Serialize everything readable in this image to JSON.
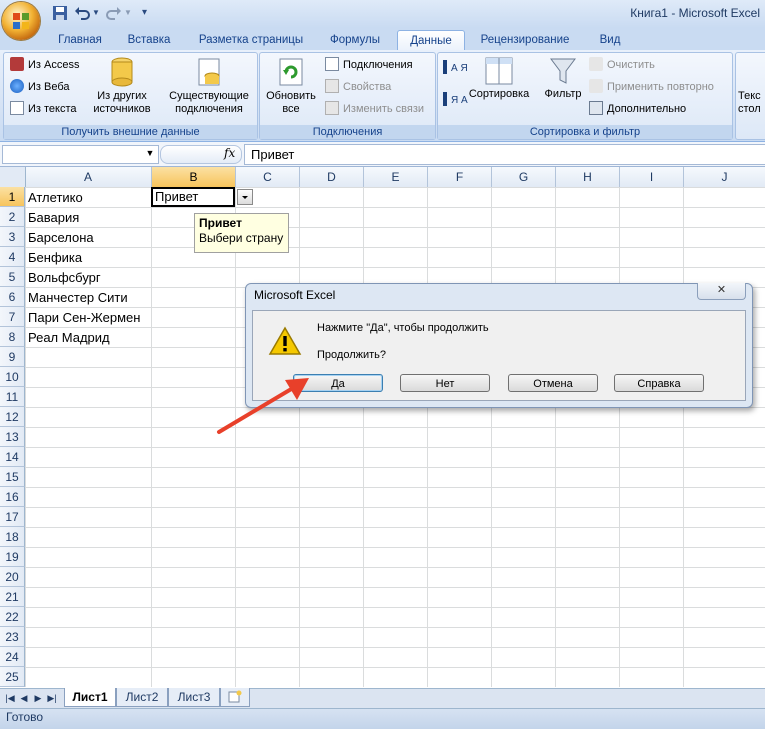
{
  "window": {
    "title": "Книга1 - Microsoft Excel"
  },
  "tabs": [
    {
      "label": "Главная",
      "active": false
    },
    {
      "label": "Вставка",
      "active": false
    },
    {
      "label": "Разметка страницы",
      "active": false
    },
    {
      "label": "Формулы",
      "active": false
    },
    {
      "label": "Данные",
      "active": true
    },
    {
      "label": "Рецензирование",
      "active": false
    },
    {
      "label": "Вид",
      "active": false
    }
  ],
  "ribbon": {
    "get_external": {
      "label": "Получить внешние данные",
      "from_access": "Из Access",
      "from_web": "Из Веба",
      "from_text": "Из текста",
      "from_other_1": "Из других",
      "from_other_2": "источников",
      "existing_1": "Существующие",
      "existing_2": "подключения"
    },
    "connections": {
      "label": "Подключения",
      "refresh_1": "Обновить",
      "refresh_2": "все",
      "connections": "Подключения",
      "properties": "Свойства",
      "edit_links": "Изменить связи"
    },
    "sort_filter": {
      "label": "Сортировка и фильтр",
      "sort": "Сортировка",
      "filter": "Фильтр",
      "clear": "Очистить",
      "reapply": "Применить повторно",
      "advanced": "Дополнительно",
      "az_top": "А Я",
      "az_bottom": "Я А"
    },
    "partial": {
      "line1": "Текс",
      "line2": "стол"
    }
  },
  "formula_bar": {
    "name_box": "",
    "fx": "fx",
    "value": "Привет"
  },
  "columns": [
    "A",
    "B",
    "C",
    "D",
    "E",
    "F",
    "G",
    "H",
    "I",
    "J"
  ],
  "rows": [
    "1",
    "2",
    "3",
    "4",
    "5",
    "6",
    "7",
    "8",
    "9",
    "10",
    "11",
    "12",
    "13",
    "14",
    "15",
    "16",
    "17",
    "18",
    "19",
    "20",
    "21",
    "22",
    "23",
    "24",
    "25"
  ],
  "cells": {
    "A": [
      "Атлетико",
      "Бавария",
      "Барселона",
      "Бенфика",
      "Вольфсбург",
      "Манчестер Сити",
      "Пари Сен-Жермен",
      "Реал Мадрид"
    ],
    "B1": "Привет"
  },
  "selected": {
    "column": "B",
    "row": "1"
  },
  "validation_tooltip": {
    "title": "Привет",
    "text": "Выбери страну"
  },
  "sheets": [
    {
      "label": "Лист1",
      "active": true
    },
    {
      "label": "Лист2",
      "active": false
    },
    {
      "label": "Лист3",
      "active": false
    }
  ],
  "status": {
    "text": "Готово"
  },
  "dialog": {
    "title": "Microsoft Excel",
    "close": "✕",
    "message": "Нажмите \"Да\", чтобы продолжить",
    "question": "Продолжить?",
    "buttons": {
      "yes": "Да",
      "no": "Нет",
      "cancel": "Отмена",
      "help": "Справка"
    }
  },
  "colors": {
    "accent": "#15428b",
    "selection": "#f7c45c",
    "arrow": "#e8402a"
  }
}
